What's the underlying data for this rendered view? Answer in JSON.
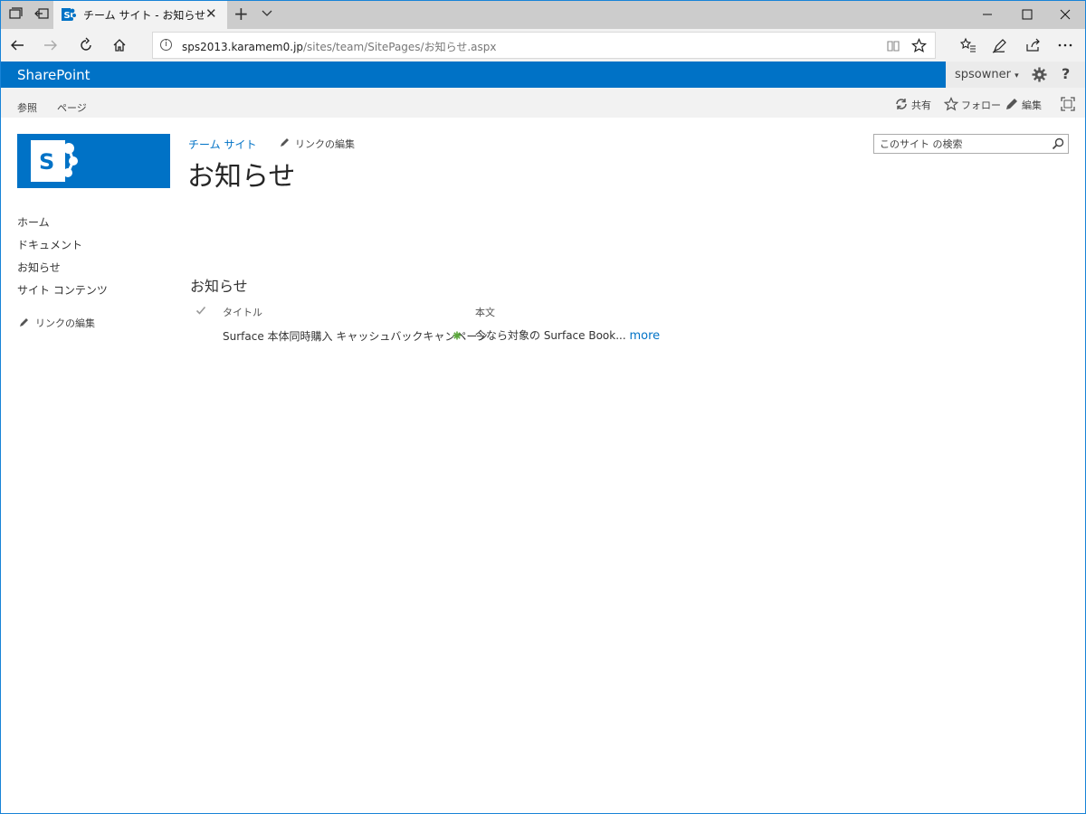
{
  "browser": {
    "tab_title": "チーム サイト - お知らせ",
    "url_host": "sps2013.karamem0.jp",
    "url_path": "/sites/team/SitePages/お知らせ.aspx"
  },
  "suite": {
    "brand": "SharePoint",
    "user": "spsowner",
    "user_caret": "▾",
    "help": "?"
  },
  "ribbon": {
    "tabs": [
      "参照",
      "ページ"
    ],
    "share": "共有",
    "follow": "フォロー",
    "edit": "編集"
  },
  "site": {
    "breadcrumb": "チーム サイト",
    "edit_links": "リンクの編集",
    "page_title": "お知らせ",
    "logo_letter": "S"
  },
  "search": {
    "placeholder": "このサイト の検索"
  },
  "quick_launch": {
    "items": [
      "ホーム",
      "ドキュメント",
      "お知らせ",
      "サイト コンテンツ"
    ],
    "edit_links": "リンクの編集"
  },
  "webpart": {
    "title": "お知らせ",
    "columns": [
      "タイトル",
      "本文"
    ],
    "rows": [
      {
        "title": "Surface 本体同時購入 キャッシュバックキャンペーン",
        "body": "今なら対象の Surface Book...",
        "more": "more"
      }
    ]
  },
  "colors": {
    "accent": "#0072c6",
    "tab_bar": "#cccccc",
    "ribbon": "#f2f2f2"
  }
}
